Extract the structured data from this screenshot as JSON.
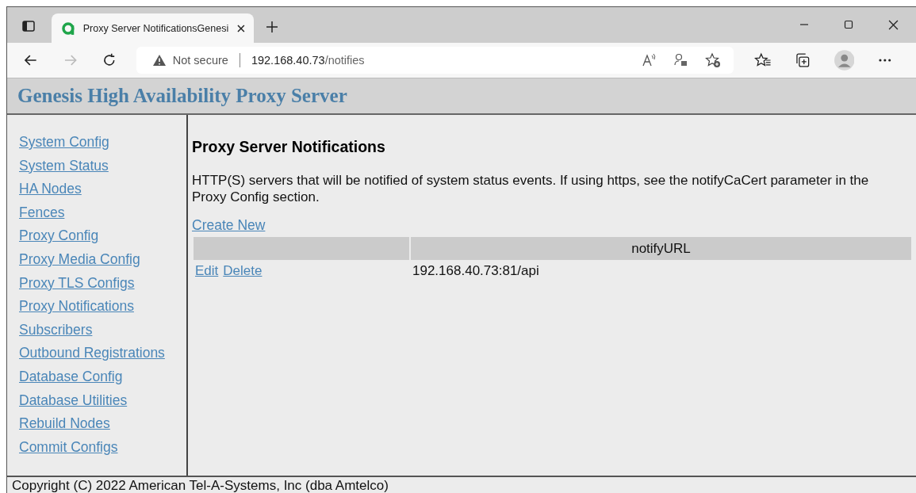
{
  "browser": {
    "tabs": [
      {
        "title": "Proxy Server NotificationsGenesi",
        "selected": true
      }
    ],
    "address": {
      "security": "Not secure",
      "host": "192.168.40.73",
      "path": "/notifies"
    }
  },
  "header": {
    "title": "Genesis High Availability Proxy Server"
  },
  "sidebar": {
    "items": [
      {
        "label": "System Config"
      },
      {
        "label": "System Status"
      },
      {
        "label": "HA Nodes"
      },
      {
        "label": "Fences"
      },
      {
        "label": "Proxy Config"
      },
      {
        "label": "Proxy Media Config"
      },
      {
        "label": "Proxy TLS Configs"
      },
      {
        "label": "Proxy Notifications"
      },
      {
        "label": "Subscribers"
      },
      {
        "label": "Outbound Registrations"
      },
      {
        "label": "Database Config"
      },
      {
        "label": "Database Utilities"
      },
      {
        "label": "Rebuild Nodes"
      },
      {
        "label": "Commit Configs"
      }
    ]
  },
  "content": {
    "heading": "Proxy Server Notifications",
    "description": "HTTP(S) servers that will be notified of system status events. If using https, see the notifyCaCert parameter in the Proxy Config section.",
    "create_link": "Create New",
    "table": {
      "columns": [
        "notifyURL"
      ],
      "rows": [
        {
          "actions": [
            "Edit",
            "Delete"
          ],
          "notifyURL": "192.168.40.73:81/api"
        }
      ]
    }
  },
  "footer": {
    "text": "Copyright (C) 2022 American Tel-A-Systems, Inc (dba Amtelco)"
  }
}
